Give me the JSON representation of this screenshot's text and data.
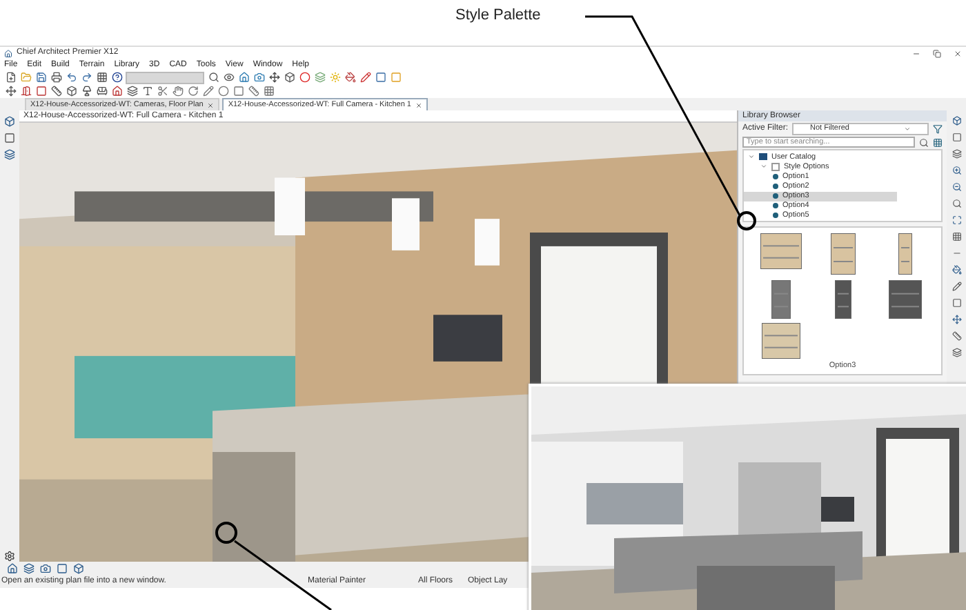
{
  "callout": {
    "label": "Style Palette"
  },
  "window": {
    "title": "Chief Architect Premier X12"
  },
  "menu": [
    "File",
    "Edit",
    "Build",
    "Terrain",
    "Library",
    "3D",
    "CAD",
    "Tools",
    "View",
    "Window",
    "Help"
  ],
  "tabs": [
    {
      "label": "X12-House-Accessorized-WT: Cameras, Floor Plan",
      "selected": false
    },
    {
      "label": "X12-House-Accessorized-WT: Full Camera - Kitchen 1",
      "selected": true
    }
  ],
  "view": {
    "title": "X12-House-Accessorized-WT: Full Camera - Kitchen 1"
  },
  "library": {
    "title": "Library Browser",
    "filter_label": "Active Filter:",
    "filter_value": "Not Filtered",
    "search_placeholder": "Type to start searching...",
    "tree": [
      {
        "label": "User Catalog",
        "expanded": true,
        "children": [
          {
            "label": "Style Options",
            "expanded": true,
            "children": [
              {
                "label": "Option1",
                "selected": false
              },
              {
                "label": "Option2",
                "selected": false
              },
              {
                "label": "Option3",
                "selected": true
              },
              {
                "label": "Option4",
                "selected": false
              },
              {
                "label": "Option5",
                "selected": false
              }
            ]
          }
        ]
      }
    ],
    "preview_caption": "Option3"
  },
  "status_bar": {
    "message": "Open an existing plan file into a new window.",
    "tool": "Material Painter",
    "floors": "All Floors",
    "layer": "Object Lay"
  }
}
